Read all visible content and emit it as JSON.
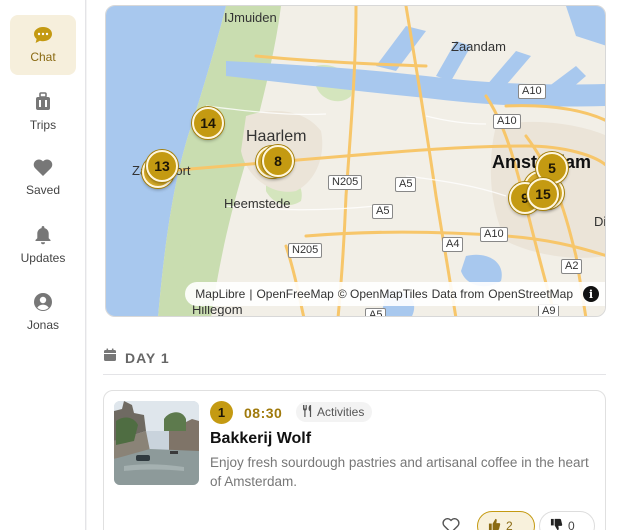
{
  "sidebar": {
    "items": [
      {
        "label": "Chat",
        "icon": "chat-bubble-icon",
        "active": true
      },
      {
        "label": "Trips",
        "icon": "suitcase-icon"
      },
      {
        "label": "Saved",
        "icon": "heart-icon"
      },
      {
        "label": "Updates",
        "icon": "bell-icon"
      },
      {
        "label": "Jonas",
        "icon": "user-avatar-icon"
      }
    ]
  },
  "map": {
    "towns": {
      "ijmuiden": "IJmuiden",
      "zaandam": "Zaandam",
      "haarlem": "Haarlem",
      "zandvoort": "Zandvoort",
      "heemstede": "Heemstede",
      "amsterdam": "Amsterdam",
      "hillegom": "Hillegom",
      "diemen": "Di"
    },
    "roads": [
      "A10",
      "A10",
      "A10",
      "N205",
      "A5",
      "A5",
      "N205",
      "A4",
      "A2",
      "A5",
      "A9"
    ],
    "markers": [
      "14",
      "13",
      "8",
      "5",
      "9",
      "15"
    ],
    "attribution": {
      "maplibre": "MapLibre",
      "sep": "|",
      "openfreemap": "OpenFreeMap",
      "copyright": "© OpenMapTiles",
      "data_from": "Data from",
      "osm": "OpenStreetMap",
      "info": "i"
    },
    "colors": {
      "marker": "#c49a12",
      "water": "#a8c8ee",
      "land": "#f2efe7",
      "park": "#c9ddb0",
      "road": "#f7c66a"
    }
  },
  "itinerary": {
    "day_label": "DAY 1",
    "items": [
      {
        "number": "1",
        "time": "08:30",
        "category": "Activities",
        "title": "Bakkerij Wolf",
        "description": "Enjoy fresh sourdough pastries and artisanal coffee in the heart of Amsterdam.",
        "upvotes": "2",
        "downvotes": "0"
      }
    ]
  }
}
